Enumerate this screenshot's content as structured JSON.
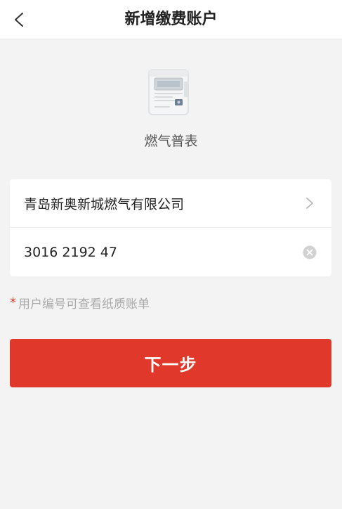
{
  "header": {
    "title": "新增缴费账户",
    "back_icon": "chevron-left-icon"
  },
  "meter": {
    "icon": "gas-meter-icon",
    "label": "燃气普表"
  },
  "form": {
    "company": "青岛新奥新城燃气有限公司",
    "company_icon": "chevron-right-icon",
    "account_value": "3016 2192 47",
    "clear_icon": "clear-circle-icon"
  },
  "hint": {
    "star": "*",
    "text": "用户编号可查看纸质账单"
  },
  "next_button": {
    "label": "下一步"
  },
  "colors": {
    "accent": "#e0382a",
    "background": "#f3f3f3"
  }
}
